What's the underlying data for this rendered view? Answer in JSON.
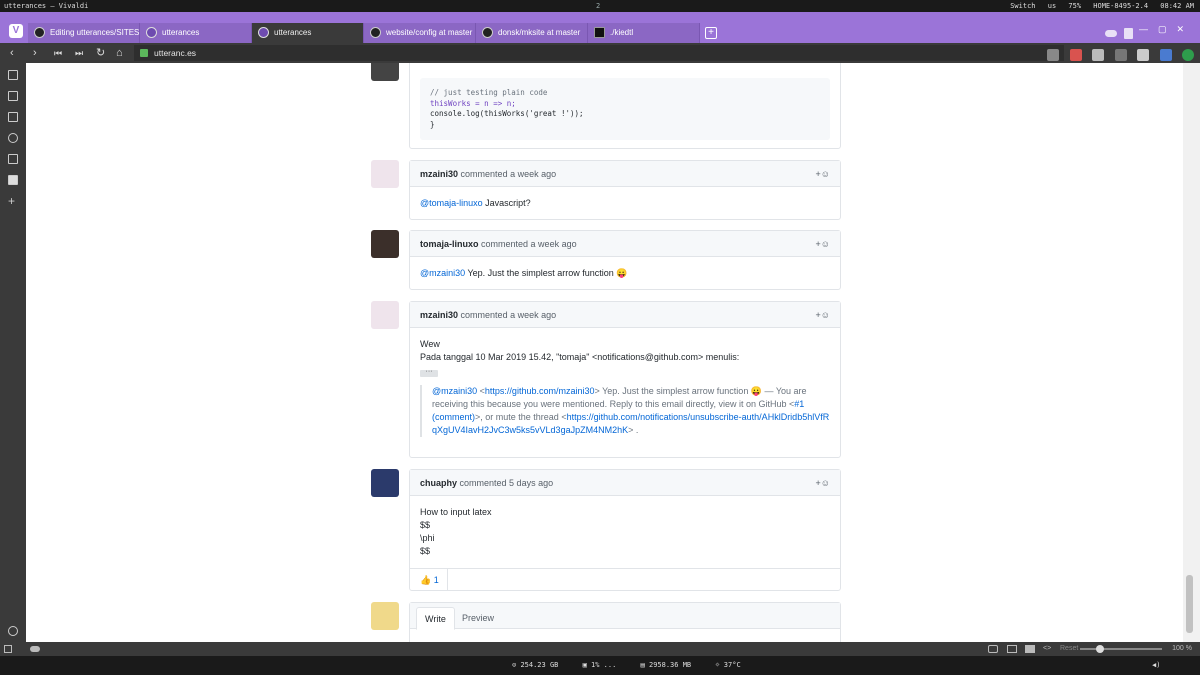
{
  "system": {
    "window_title": "utterances – Vivaldi",
    "workspace": "2",
    "right_items": [
      "Switch",
      "us",
      "75%",
      "HOME-8495-2.4",
      "08:42 AM"
    ]
  },
  "tabs": [
    {
      "label": "Editing utterances/SITES"
    },
    {
      "label": "utterances"
    },
    {
      "label": "utterances"
    },
    {
      "label": "website/config at master"
    },
    {
      "label": "donsk/mksite at master"
    },
    {
      "label": "./kiedtl"
    }
  ],
  "address": {
    "url": "utteranc.es"
  },
  "code_comment": {
    "lines": [
      "// just testing plain code",
      "thisWorks = n => n;",
      "console.log(thisWorks('great !'));",
      "}"
    ]
  },
  "comments": [
    {
      "author": "mzaini30",
      "meta": "commented a week ago",
      "mention": "@tomaja-linuxo",
      "text": " Javascript?"
    },
    {
      "author": "tomaja-linuxo",
      "meta": "commented a week ago",
      "mention": "@mzaini30",
      "text": " Yep. Just the simplest arrow function 😛"
    },
    {
      "author": "mzaini30",
      "meta": "commented a week ago",
      "line1": "Wew",
      "line2": "Pada tanggal 10 Mar 2019 15.42, \"tomaja\" <notifications@github.com> menulis:",
      "dots": "···",
      "q_mention": "@mzaini30",
      "q_open": " <",
      "q_link1": "https://github.com/mzaini30",
      "q_mid1": "> Yep. Just the simplest arrow function 😛 — You are receiving this because you were mentioned. Reply to this email directly, view it on GitHub <",
      "q_link2": "#1 (comment)",
      "q_mid2": ">, or mute the thread <",
      "q_link3": "https://github.com/notifications/unsubscribe-auth/AHklDridb5hlVfRqXgUV4IavH2JvC3w5ks5vVLd3gaJpZM4NM2hK",
      "q_end": "> ."
    },
    {
      "author": "chuaphy",
      "meta": "commented 5 days ago",
      "lines": [
        "How to input latex",
        "$$",
        "\\phi",
        "$$"
      ],
      "reaction": "👍 1"
    }
  ],
  "editor": {
    "tab_write": "Write",
    "tab_preview": "Preview"
  },
  "react_icon": "+☺",
  "statusbar": {
    "reset": "Reset",
    "zoom": "100 %"
  },
  "bottombar": {
    "disk": "254.23 GB",
    "cpu": "1% ...",
    "mem": "2958.36 MB",
    "temp": "37°C"
  },
  "icons": [
    "vivaldi-logo-icon",
    "github-icon",
    "utterances-icon",
    "terminal-icon",
    "back-icon",
    "forward-icon",
    "rewind-icon",
    "fast-forward-icon",
    "reload-icon",
    "home-icon",
    "lock-icon",
    "bookmark-icon",
    "download-icon",
    "notes-icon",
    "history-icon",
    "window-icon",
    "panel-icon",
    "add-icon",
    "gear-icon",
    "cloud-icon",
    "trash-icon",
    "camera-icon",
    "image-icon",
    "code-icon",
    "volume-icon"
  ]
}
